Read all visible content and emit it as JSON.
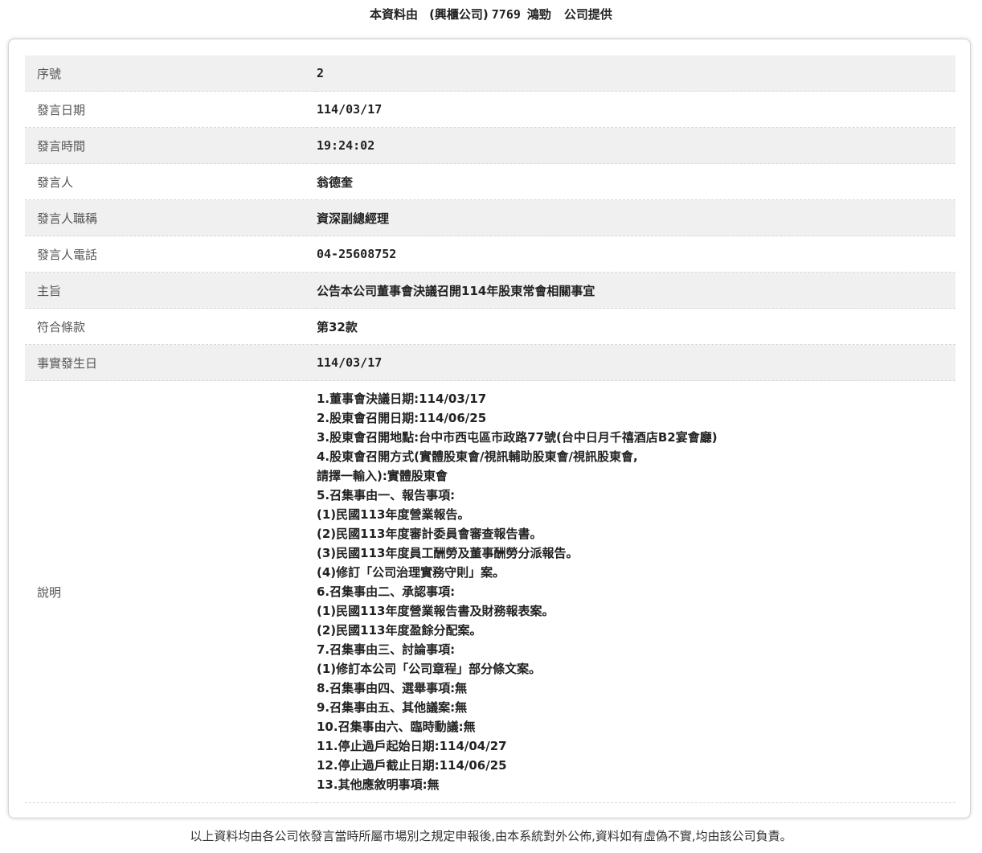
{
  "header": {
    "prefix": "本資料由",
    "market": "(興櫃公司)",
    "code": "7769",
    "name": "鴻勁",
    "suffix": "公司提供"
  },
  "rows": [
    {
      "label": "序號",
      "value": "2"
    },
    {
      "label": "發言日期",
      "value": "114/03/17"
    },
    {
      "label": "發言時間",
      "value": "19:24:02"
    },
    {
      "label": "發言人",
      "value": "翁德奎"
    },
    {
      "label": "發言人職稱",
      "value": "資深副總經理"
    },
    {
      "label": "發言人電話",
      "value": "04-25608752"
    },
    {
      "label": "主旨",
      "value": "公告本公司董事會決議召開114年股東常會相關事宜"
    },
    {
      "label": "符合條款",
      "value": "第32款"
    },
    {
      "label": "事實發生日",
      "value": "114/03/17"
    }
  ],
  "description": {
    "label": "說明",
    "lines": [
      "1.董事會決議日期:114/03/17",
      "2.股東會召開日期:114/06/25",
      "3.股東會召開地點:台中市西屯區市政路77號(台中日月千禧酒店B2宴會廳)",
      "4.股東會召開方式(實體股東會/視訊輔助股東會/視訊股東會,",
      "請擇一輸入):實體股東會",
      "5.召集事由一、報告事項:",
      "(1)民國113年度營業報告。",
      "(2)民國113年度審計委員會審查報告書。",
      "(3)民國113年度員工酬勞及董事酬勞分派報告。",
      "(4)修訂「公司治理實務守則」案。",
      "6.召集事由二、承認事項:",
      "(1)民國113年度營業報告書及財務報表案。",
      "(2)民國113年度盈餘分配案。",
      "7.召集事由三、討論事項:",
      "(1)修訂本公司「公司章程」部分條文案。",
      "8.召集事由四、選舉事項:無",
      "9.召集事由五、其他議案:無",
      "10.召集事由六、臨時動議:無",
      "11.停止過戶起始日期:114/04/27",
      "12.停止過戶截止日期:114/06/25",
      "13.其他應敘明事項:無"
    ]
  },
  "footer": {
    "note": "以上資料均由各公司依發言當時所屬市場別之規定申報後,由本系統對外公佈,資料如有虛偽不實,均由該公司負責。"
  }
}
